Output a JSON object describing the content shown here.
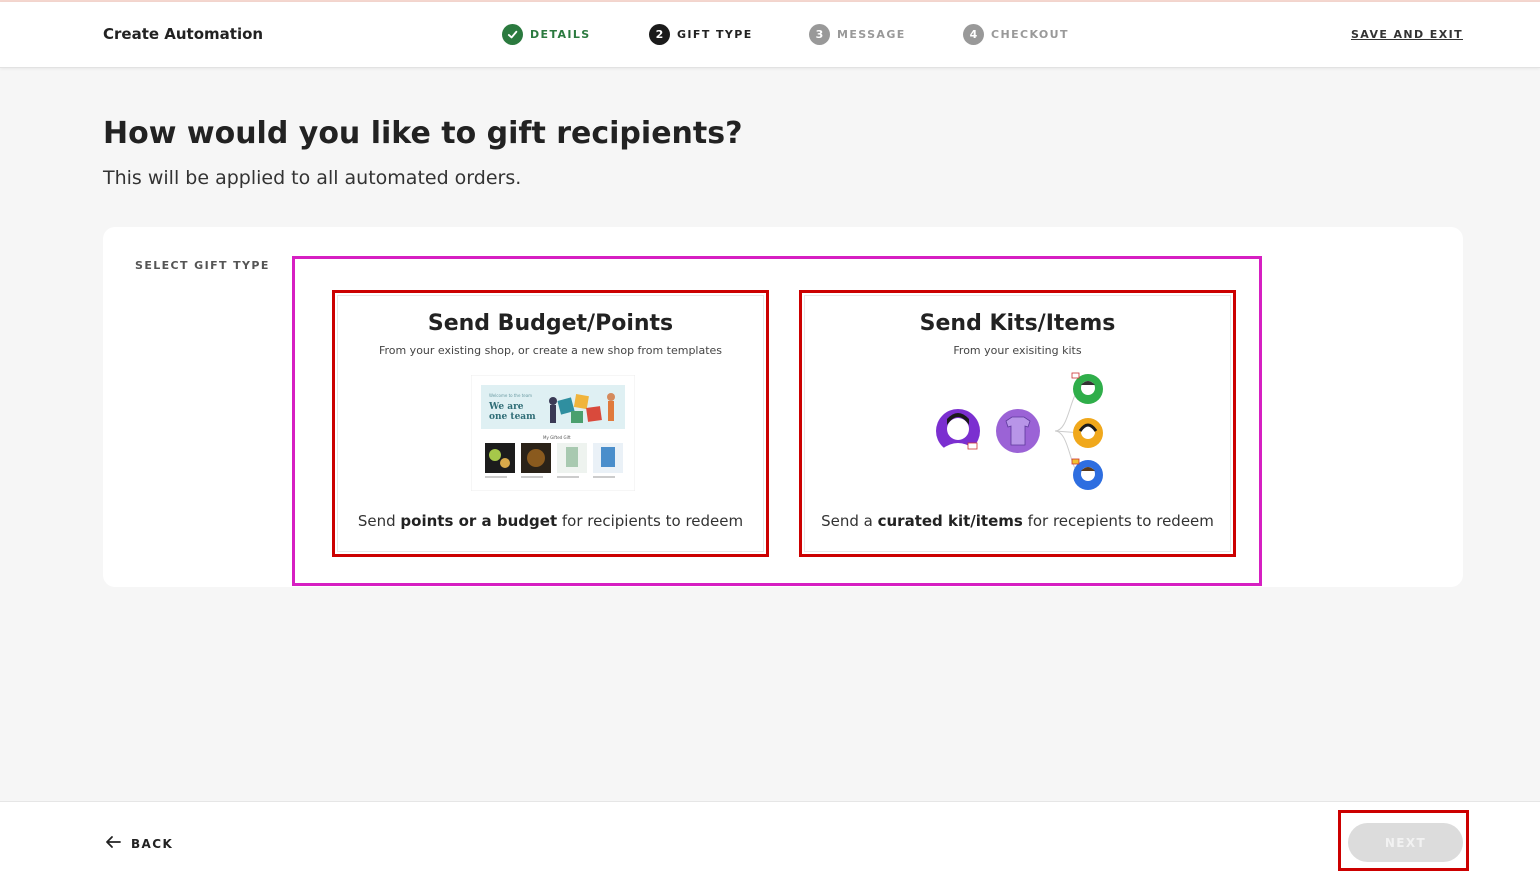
{
  "header": {
    "title": "Create Automation",
    "save_exit": "SAVE AND EXIT",
    "steps": [
      {
        "num": "✓",
        "label": "DETAILS",
        "state": "done"
      },
      {
        "num": "2",
        "label": "GIFT TYPE",
        "state": "active"
      },
      {
        "num": "3",
        "label": "MESSAGE",
        "state": "pending"
      },
      {
        "num": "4",
        "label": "CHECKOUT",
        "state": "pending"
      }
    ]
  },
  "main": {
    "title": "How would you like to gift recipients?",
    "subtitle": "This will be applied to all automated orders.",
    "select_label": "SELECT GIFT TYPE",
    "cards": [
      {
        "title": "Send Budget/Points",
        "subtitle": "From your existing shop, or create a new shop from templates",
        "desc_pre": "Send ",
        "desc_bold": "points or a budget",
        "desc_post": " for recipients to redeem",
        "illustration_text": "We are one team",
        "illustration_caption": "Welcome to the team",
        "illustration_small": "My Gifted Gift"
      },
      {
        "title": "Send Kits/Items",
        "subtitle": "From your exisiting kits",
        "desc_pre": "Send a ",
        "desc_bold": "curated kit/items",
        "desc_post": " for recepients to redeem"
      }
    ]
  },
  "footer": {
    "back_label": "BACK",
    "next_label": "NEXT"
  },
  "colors": {
    "done_green": "#2b7a3f",
    "accent_purple": "#7b2fd0",
    "highlight_red": "#cc0000",
    "highlight_magenta": "#d61fc2"
  }
}
